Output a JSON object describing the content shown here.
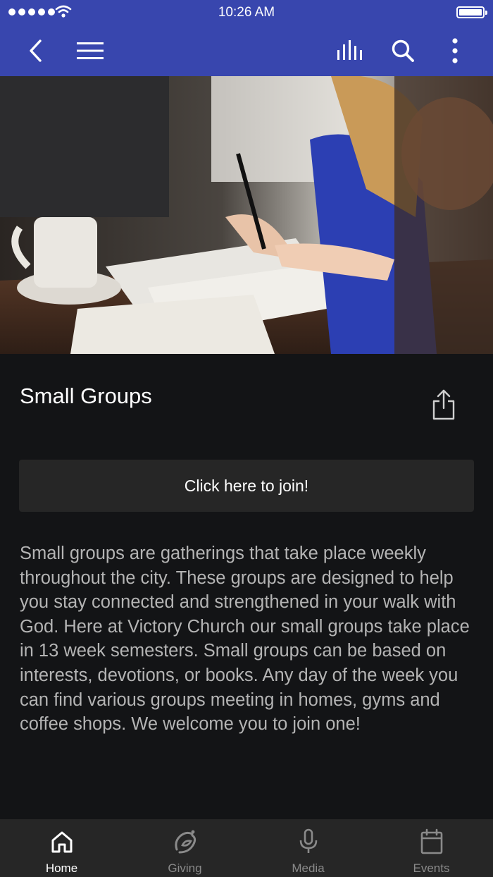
{
  "status_bar": {
    "time": "10:26 AM"
  },
  "nav": {
    "back_icon": "chevron-left-icon",
    "menu_icon": "hamburger-menu-icon",
    "audio_icon": "audio-bars-icon",
    "search_icon": "search-icon",
    "more_icon": "vertical-dots-icon",
    "color": "#3846ae"
  },
  "hero": {
    "description": "photo of people writing in notebooks at a cafe table"
  },
  "page": {
    "title": "Small Groups",
    "share_icon": "share-icon",
    "join_label": "Click here to join!",
    "description": "Small groups are gatherings that take place weekly throughout the city. These groups are designed to help you stay connected and strengthened in your walk with God. Here at Victory Church our small groups take place in 13 week semesters. Small groups can be based on interests, devotions, or books. Any day of the week you can find various groups meeting in homes, gyms and coffee shops. We welcome you to join one!"
  },
  "tabs": [
    {
      "label": "Home",
      "icon": "home-icon",
      "active": true
    },
    {
      "label": "Giving",
      "icon": "giving-icon",
      "active": false
    },
    {
      "label": "Media",
      "icon": "microphone-icon",
      "active": false
    },
    {
      "label": "Events",
      "icon": "calendar-icon",
      "active": false
    }
  ],
  "colors": {
    "background": "#131416",
    "tabbar": "#262626",
    "button": "#262626",
    "text_muted": "#b4b4b4"
  }
}
